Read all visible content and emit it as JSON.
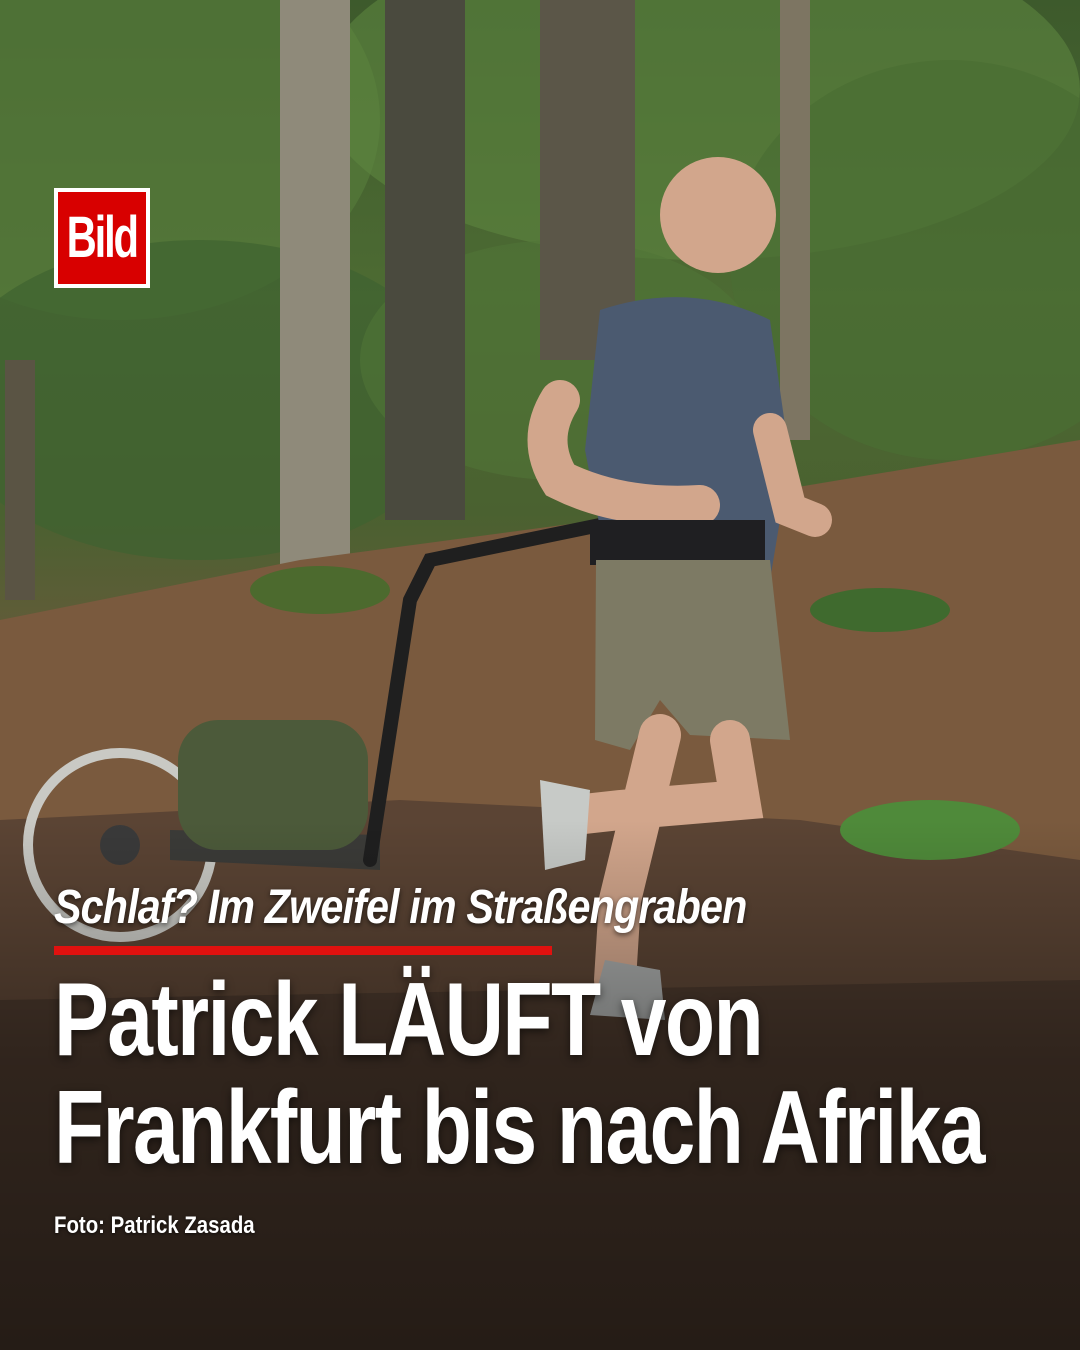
{
  "brand": {
    "logo_text": "Bild",
    "logo_color": "#d80000"
  },
  "post": {
    "kicker": "Schlaf? Im Zweifel im Straßengraben",
    "headline_line1": "Patrick LÄUFT von",
    "headline_line2": "Frankfurt bis nach Afrika",
    "photo_credit": "Foto: Patrick Zasada",
    "accent_color": "#e0110f"
  }
}
